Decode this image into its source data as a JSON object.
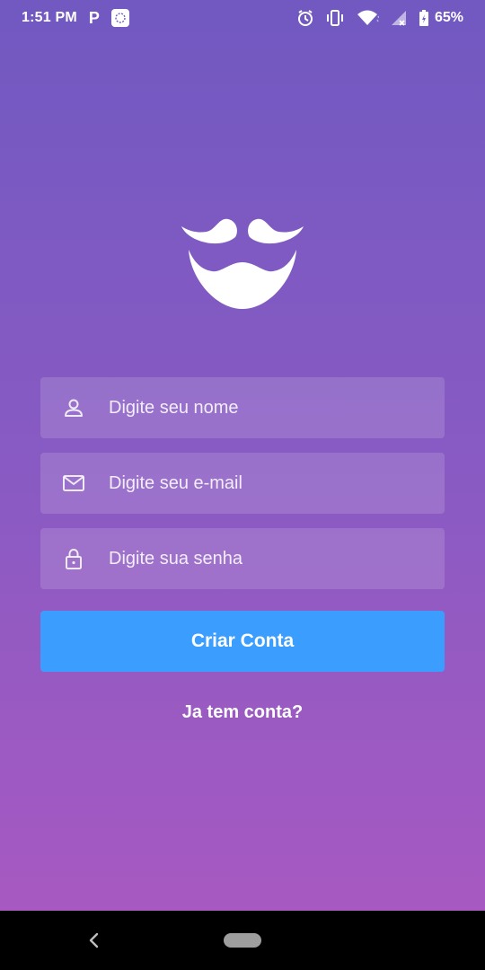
{
  "status_bar": {
    "time": "1:51 PM",
    "app_badge": "P",
    "battery_percent": "65%",
    "icons": [
      "notification-icon",
      "alarm-icon",
      "vibrate-icon",
      "wifi-icon",
      "signal-icon",
      "battery-icon"
    ]
  },
  "logo": {
    "icon": "mustache-beard-logo"
  },
  "form": {
    "name_placeholder": "Digite seu nome",
    "name_value": "",
    "name_icon": "user-icon",
    "email_placeholder": "Digite seu e-mail",
    "email_value": "",
    "email_icon": "mail-icon",
    "password_placeholder": "Digite sua senha",
    "password_value": "",
    "password_icon": "lock-icon"
  },
  "actions": {
    "create_account": "Criar Conta",
    "have_account": "Ja tem conta?"
  },
  "colors": {
    "gradient_top": "#7159c1",
    "gradient_bottom": "#ab59c1",
    "primary_button": "#3b9eff"
  },
  "navigation": {
    "back_icon": "chevron-left-icon",
    "home_icon": "home-pill"
  }
}
